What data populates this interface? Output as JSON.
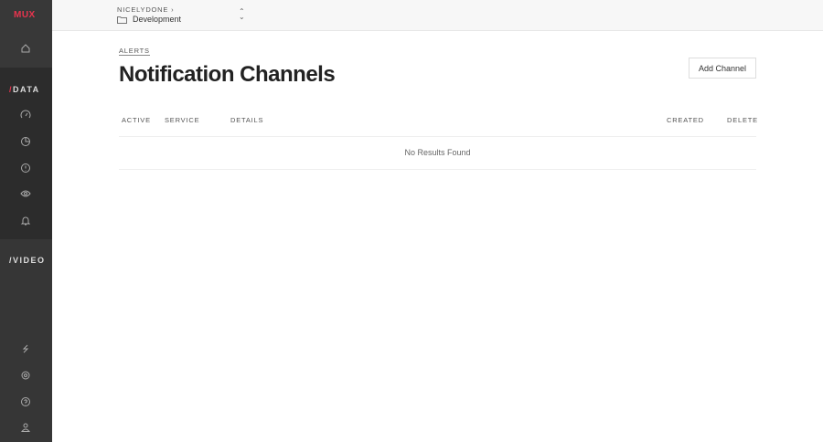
{
  "sidebar": {
    "logo": "MUX",
    "data_label": "DATA",
    "video_label": "VIDEO",
    "slash": "/"
  },
  "header": {
    "org": "NICELYDONE ›",
    "environment": "Development"
  },
  "main": {
    "breadcrumb": "ALERTS",
    "title": "Notification Channels",
    "add_button": "Add Channel",
    "columns": [
      "ACTIVE",
      "SERVICE",
      "DETAILS",
      "CREATED",
      "DELETE"
    ],
    "empty": "No Results Found"
  }
}
